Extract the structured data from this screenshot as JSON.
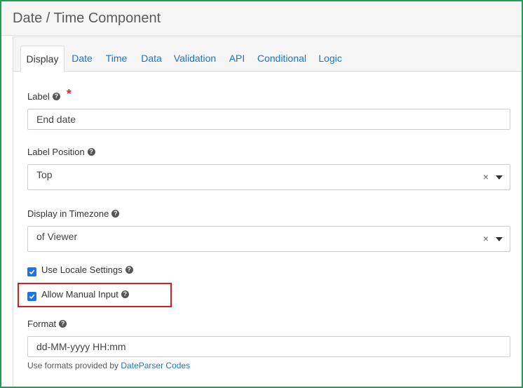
{
  "title": "Date / Time Component",
  "tabs": [
    {
      "label": "Display",
      "active": true
    },
    {
      "label": "Date"
    },
    {
      "label": "Time"
    },
    {
      "label": "Data"
    },
    {
      "label": "Validation"
    },
    {
      "label": "API"
    },
    {
      "label": "Conditional"
    },
    {
      "label": "Logic"
    }
  ],
  "label_field": {
    "label": "Label",
    "value": "End date",
    "required_mark": "*"
  },
  "label_position": {
    "label": "Label Position",
    "value": "Top",
    "clear": "×"
  },
  "timezone": {
    "label": "Display in Timezone",
    "value": "of Viewer",
    "clear": "×"
  },
  "locale": {
    "label": "Use Locale Settings",
    "checked": true
  },
  "manual_input": {
    "label": "Allow Manual Input",
    "checked": true
  },
  "format": {
    "label": "Format",
    "value": "dd-MM-yyyy HH:mm",
    "hint_prefix": "Use formats provided by ",
    "hint_link": "DateParser Codes"
  },
  "help_glyph": "?",
  "colors": {
    "accent": "#1a73e8",
    "link": "#1a73c8",
    "required": "#d32f2f",
    "highlight": "#cc2222",
    "frame": "#1f9d55"
  }
}
